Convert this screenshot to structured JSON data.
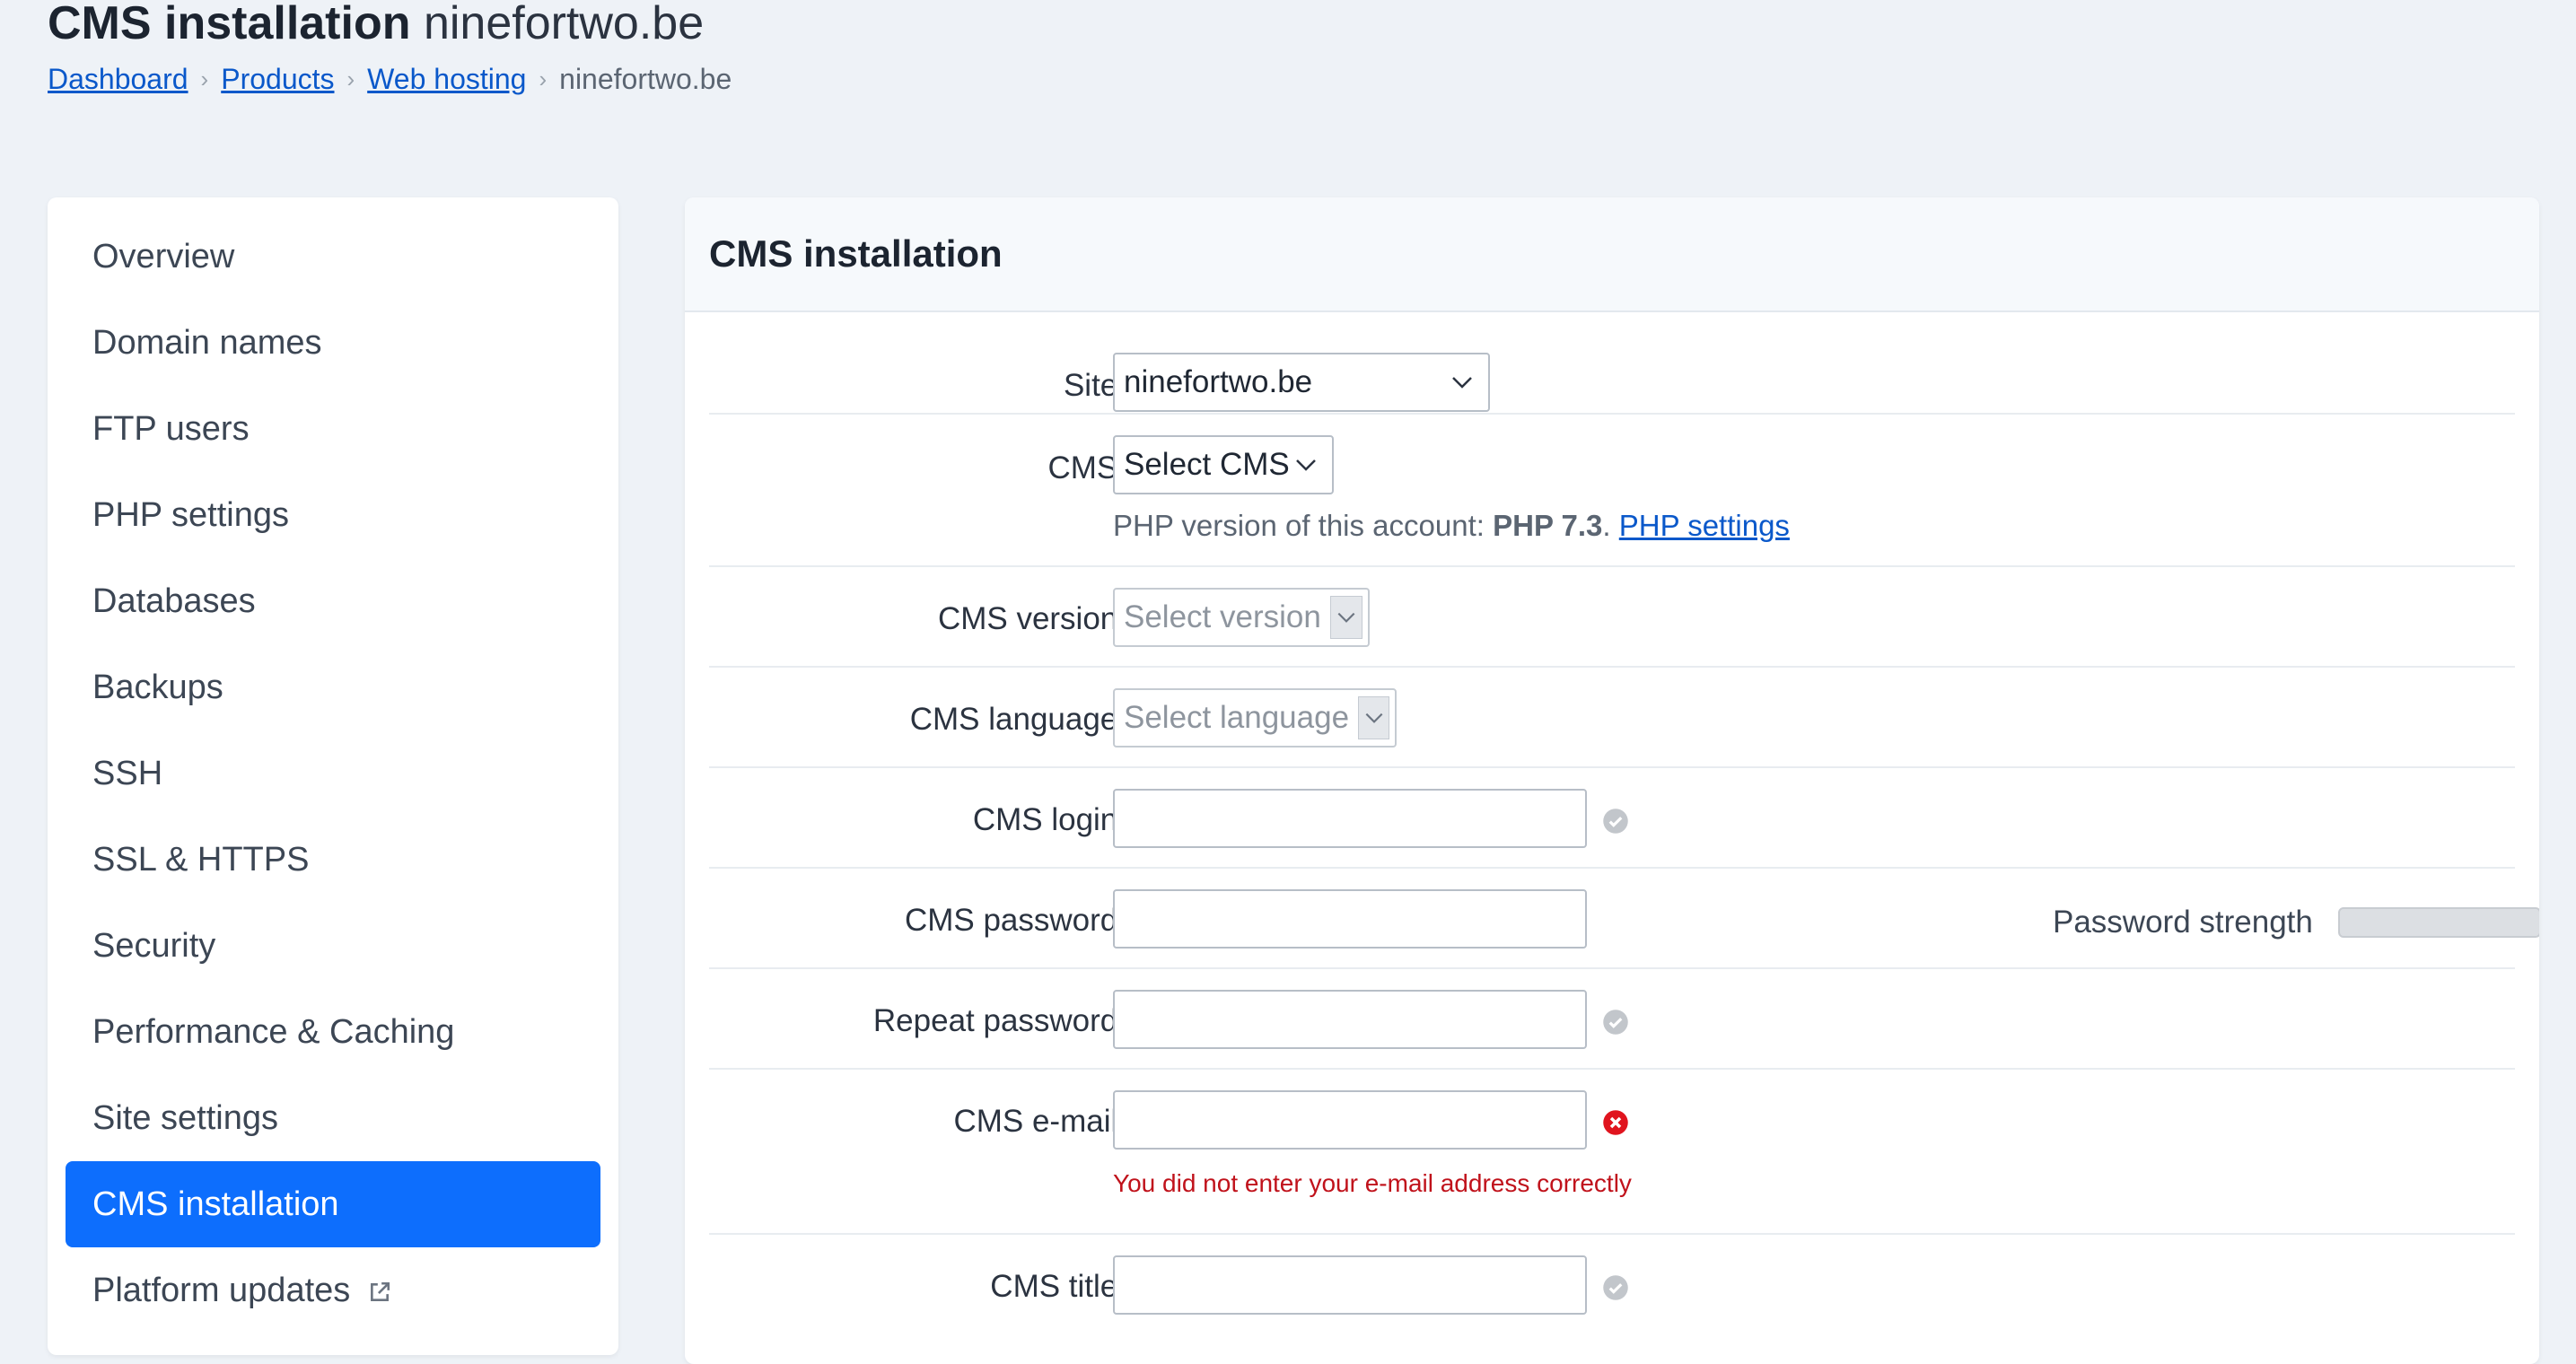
{
  "header": {
    "title": "CMS installation",
    "domain": "ninefortwo.be",
    "breadcrumb": [
      "Dashboard",
      "Products",
      "Web hosting"
    ],
    "breadcrumb_current": "ninefortwo.be"
  },
  "sidebar": {
    "items": [
      {
        "label": "Overview"
      },
      {
        "label": "Domain names"
      },
      {
        "label": "FTP users"
      },
      {
        "label": "PHP settings"
      },
      {
        "label": "Databases"
      },
      {
        "label": "Backups"
      },
      {
        "label": "SSH"
      },
      {
        "label": "SSL & HTTPS"
      },
      {
        "label": "Security"
      },
      {
        "label": "Performance & Caching"
      },
      {
        "label": "Site settings"
      },
      {
        "label": "CMS installation",
        "active": true
      },
      {
        "label": "Platform updates",
        "icon": "external-link-icon"
      }
    ]
  },
  "panel": {
    "title": "CMS installation",
    "site": {
      "label": "Site:",
      "value": "ninefortwo.be"
    },
    "cms": {
      "label": "CMS:",
      "value": "Select CMS",
      "hint_prefix": "PHP version of this account:",
      "php_version": "PHP 7.3",
      "hint_sep": ".",
      "php_link": "PHP settings"
    },
    "cms_version": {
      "label": "CMS version:",
      "value": "Select version"
    },
    "cms_language": {
      "label": "CMS language:",
      "value": "Select language"
    },
    "cms_login": {
      "label": "CMS login:",
      "value": "",
      "status": "check-icon"
    },
    "cms_password": {
      "label": "CMS password:",
      "value": "",
      "strength_label": "Password strength",
      "strength": 0
    },
    "repeat_password": {
      "label": "Repeat password:",
      "value": "",
      "status": "check-icon"
    },
    "cms_email": {
      "label": "CMS e-mail:",
      "value": "",
      "status": "error-icon",
      "error": "You did not enter your e-mail address correctly"
    },
    "cms_title": {
      "label": "CMS title:",
      "value": "",
      "status": "check-icon"
    }
  },
  "colors": {
    "accent": "#0d6efd",
    "link": "#0a58ca",
    "error": "#c0121b",
    "background": "#eef2f7"
  }
}
